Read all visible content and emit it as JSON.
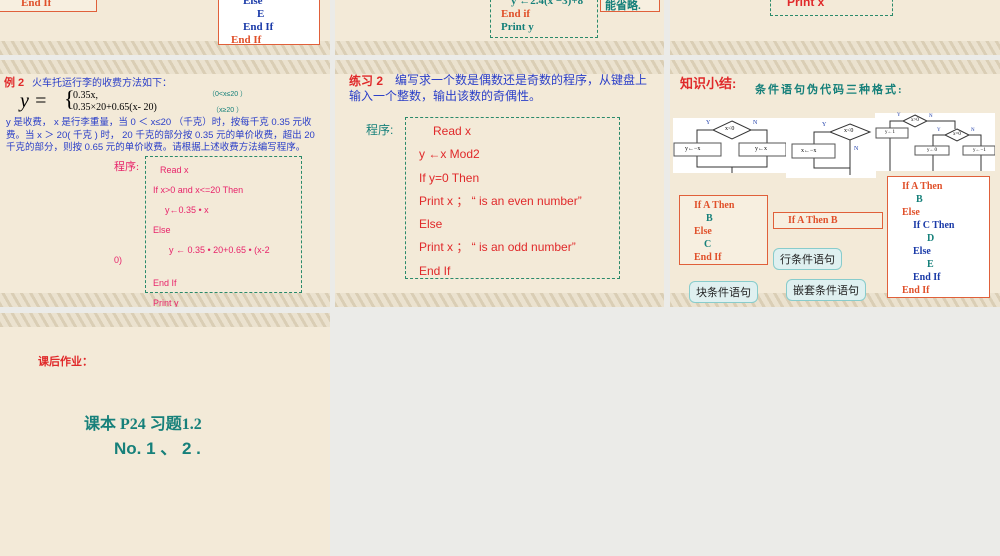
{
  "row1": {
    "s1_box1": "End If",
    "s1_box2": [
      "Else",
      "E",
      "End If",
      "End If"
    ],
    "s2_code": [
      "y ←2.4(x −3)+8",
      "End if",
      "Print y"
    ],
    "s2_note": "能省略.",
    "s3_code": "Print x"
  },
  "example2": {
    "title_label": "例 2",
    "title": "火车托运行李的收费方法如下：",
    "y": "y =",
    "case1": "0.35x,",
    "case2": "0.35×20+0.65(x- 20)",
    "cond1": "（0<x≤20 ）",
    "cond2": "（x≥20 ）",
    "description": "y 是收费， x 是行李重量，当 0 ＜ x≤20 （千克）时，按每千克 0.35 元收费。当 x ＞ 20( 千克 ) 时， 20 千克的部分按 0.35 元的单价收费，超出 20 千克的部分，则按 0.65 元的单价收费。请根据上述收费方法编写程序。",
    "program_label": "程序:",
    "code": [
      "Read x",
      "If x>0 and x<=20 Then",
      "y←0.35 • x",
      "Else",
      "y ← 0.35 • 20+0.65 • (x-2",
      "End  If",
      "Print y"
    ],
    "overflow": "0)"
  },
  "exercise2": {
    "title_label": "练习 2",
    "title": "编写求一个数是偶数还是奇数的程序，从键盘上输入一个整数，输出该数的奇偶性。",
    "program_label": "程序:",
    "code": [
      "Read x",
      "y ←x Mod2",
      "If  y=0  Then",
      "Print x  ；   “ is an even number”",
      "Else",
      "Print x  ；   “ is an odd number”",
      "End If"
    ]
  },
  "summary": {
    "title": "知识小结:",
    "subtitle": "条件语句伪代码三种格式:",
    "fc1": {
      "yes": "Y",
      "no": "N",
      "cond": "x<0",
      "left": "y←−x",
      "right": "y←x"
    },
    "fc2": {
      "yes": "Y",
      "no": "N",
      "cond": "x<0",
      "left": "x←−x"
    },
    "fc3": {
      "yes": "Y",
      "no": "N",
      "cond": "x>0",
      "left": "y←1",
      "yes2": "Y",
      "no2": "N",
      "cond2": "x=0",
      "mid": "y←0",
      "right": "y←−1"
    },
    "block_code": [
      "If  A  Then",
      "B",
      "Else",
      "C",
      "End If"
    ],
    "line_code": "If  A  Then  B",
    "nested_code": [
      "If  A  Then",
      "B",
      "Else",
      "If  C  Then",
      "D",
      "Else",
      "E",
      "End If",
      "End If"
    ],
    "callout_block": "块条件语句",
    "callout_line": "行条件语句",
    "callout_nested": "嵌套条件语句"
  },
  "homework": {
    "title": "课后作业：",
    "line1": "课本  P24  习题1.2",
    "line2": "No. 1 、 2 ."
  }
}
